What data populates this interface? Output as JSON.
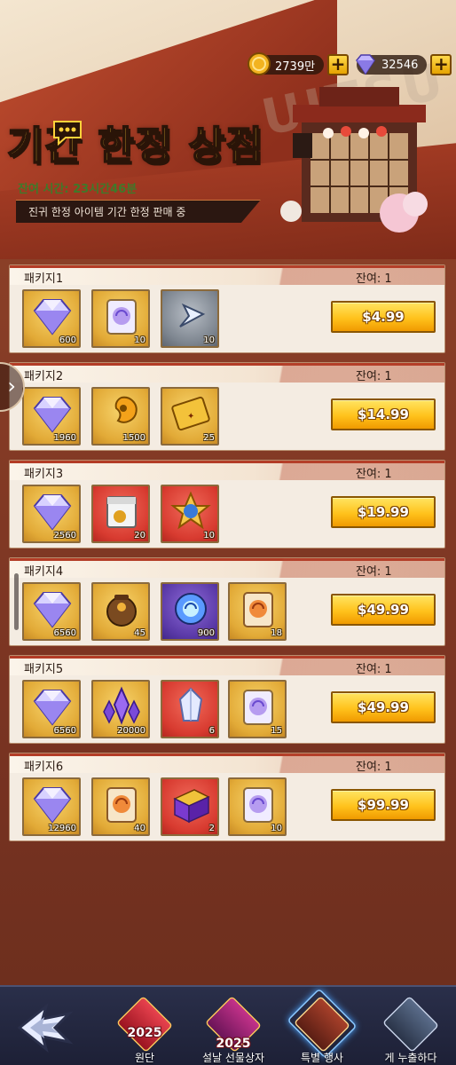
{
  "header": {
    "gold": "2739만",
    "gems": "32546",
    "title": "기간 한정 상점",
    "time_prefix": "잔여 시간:",
    "time_value": "23시간46분",
    "banner": "진귀 한정 아이템 기간 한정 판매 중",
    "watermark": "UITSU"
  },
  "packages": [
    {
      "name": "패키지1",
      "stock": "잔여: 1",
      "price": "$4.99",
      "items": [
        {
          "icon": "gem-icon",
          "bg": "gold",
          "qty": "600"
        },
        {
          "icon": "summon-ticket-icon",
          "bg": "gold",
          "qty": "10"
        },
        {
          "icon": "shard-arrow-icon",
          "bg": "gray",
          "qty": "10"
        }
      ]
    },
    {
      "name": "패키지2",
      "stock": "잔여: 1",
      "price": "$14.99",
      "items": [
        {
          "icon": "gem-icon",
          "bg": "gold",
          "qty": "1960"
        },
        {
          "icon": "magatama-icon",
          "bg": "gold",
          "qty": "1500"
        },
        {
          "icon": "golden-ticket-icon",
          "bg": "gold",
          "qty": "25"
        }
      ]
    },
    {
      "name": "패키지3",
      "stock": "잔여: 1",
      "price": "$19.99",
      "items": [
        {
          "icon": "gem-icon",
          "bg": "gold",
          "qty": "2560"
        },
        {
          "icon": "supply-bag-icon",
          "bg": "red",
          "qty": "20"
        },
        {
          "icon": "star-badge-icon",
          "bg": "red",
          "qty": "10"
        }
      ]
    },
    {
      "name": "패키지4",
      "stock": "잔여: 1",
      "price": "$49.99",
      "items": [
        {
          "icon": "gem-icon",
          "bg": "gold",
          "qty": "6560"
        },
        {
          "icon": "pouch-icon",
          "bg": "gold",
          "qty": "45"
        },
        {
          "icon": "spirit-orb-icon",
          "bg": "purple",
          "qty": "900"
        },
        {
          "icon": "orange-ticket-icon",
          "bg": "gold",
          "qty": "18"
        }
      ]
    },
    {
      "name": "패키지5",
      "stock": "잔여: 1",
      "price": "$49.99",
      "items": [
        {
          "icon": "gem-icon",
          "bg": "gold",
          "qty": "6560"
        },
        {
          "icon": "crystal-cluster-icon",
          "bg": "gold",
          "qty": "20000"
        },
        {
          "icon": "crystal-icon",
          "bg": "red",
          "qty": "6"
        },
        {
          "icon": "summon-ticket-icon",
          "bg": "gold",
          "qty": "15"
        }
      ]
    },
    {
      "name": "패키지6",
      "stock": "잔여: 1",
      "price": "$99.99",
      "items": [
        {
          "icon": "gem-icon",
          "bg": "gold",
          "qty": "12960"
        },
        {
          "icon": "orange-ticket-icon",
          "bg": "gold",
          "qty": "40"
        },
        {
          "icon": "purple-box-icon",
          "bg": "red",
          "qty": "2"
        },
        {
          "icon": "summon-ticket-icon",
          "bg": "gold",
          "qty": "10"
        }
      ]
    }
  ],
  "nav": {
    "tabs": [
      {
        "label": "원단",
        "badge_text": "2025"
      },
      {
        "label": "설날 선물상자",
        "badge_text": "2025"
      },
      {
        "label": "특별 행사",
        "badge_text": ""
      },
      {
        "label": "게 누출하다",
        "badge_text": ""
      }
    ]
  },
  "colors": {
    "accent_red": "#b33c26",
    "buy_button": "#ffc21c",
    "title_yellow": "#ffd23a",
    "time_green": "#3e7a2a"
  }
}
